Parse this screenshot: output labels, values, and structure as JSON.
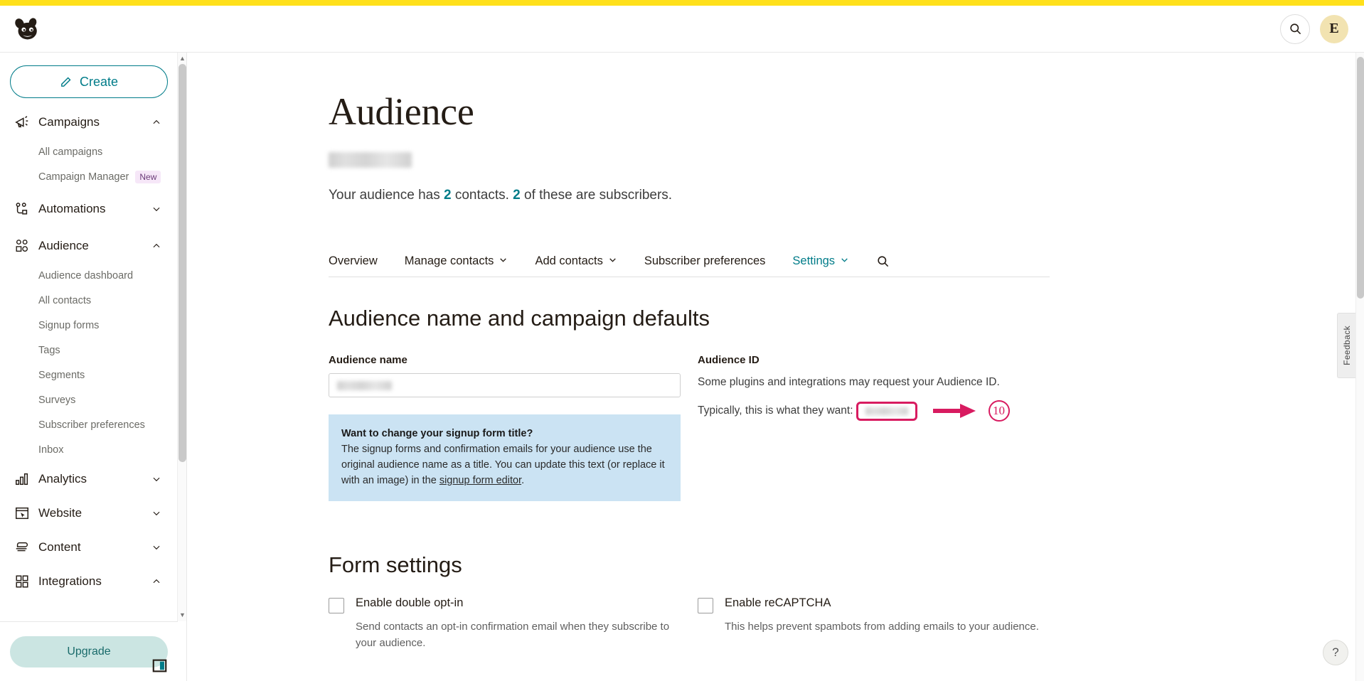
{
  "header": {
    "logo_name": "mailchimp-logo",
    "search_icon": "search-icon",
    "avatar_initial": "E"
  },
  "sidebar": {
    "create_label": "Create",
    "groups": [
      {
        "label": "Campaigns",
        "icon": "megaphone-icon",
        "expanded": true,
        "chevron": "chevron-up",
        "items": [
          {
            "label": "All campaigns",
            "badge": ""
          },
          {
            "label": "Campaign Manager",
            "badge": "New"
          }
        ]
      },
      {
        "label": "Automations",
        "icon": "automations-icon",
        "expanded": false,
        "chevron": "chevron-down",
        "items": []
      },
      {
        "label": "Audience",
        "icon": "audience-icon",
        "expanded": true,
        "chevron": "chevron-up",
        "items": [
          {
            "label": "Audience dashboard",
            "badge": ""
          },
          {
            "label": "All contacts",
            "badge": ""
          },
          {
            "label": "Signup forms",
            "badge": ""
          },
          {
            "label": "Tags",
            "badge": ""
          },
          {
            "label": "Segments",
            "badge": ""
          },
          {
            "label": "Surveys",
            "badge": ""
          },
          {
            "label": "Subscriber preferences",
            "badge": ""
          },
          {
            "label": "Inbox",
            "badge": ""
          }
        ]
      },
      {
        "label": "Analytics",
        "icon": "bar-chart-icon",
        "expanded": false,
        "chevron": "chevron-down",
        "items": []
      },
      {
        "label": "Website",
        "icon": "website-icon",
        "expanded": false,
        "chevron": "chevron-down",
        "items": []
      },
      {
        "label": "Content",
        "icon": "content-icon",
        "expanded": false,
        "chevron": "chevron-down",
        "items": []
      },
      {
        "label": "Integrations",
        "icon": "grid-icon",
        "expanded": true,
        "chevron": "chevron-up",
        "items": []
      }
    ],
    "upgrade_label": "Upgrade",
    "panel_toggle_icon": "panel-collapse-icon"
  },
  "page": {
    "title": "Audience",
    "audience_name_redacted": true,
    "contacts_prefix": "Your audience has ",
    "contacts_count": "2",
    "contacts_middle": " contacts. ",
    "subscribers_count": "2",
    "contacts_suffix": " of these are subscribers."
  },
  "tabs": [
    {
      "label": "Overview",
      "has_caret": false,
      "active": false
    },
    {
      "label": "Manage contacts",
      "has_caret": true,
      "active": false
    },
    {
      "label": "Add contacts",
      "has_caret": true,
      "active": false
    },
    {
      "label": "Subscriber preferences",
      "has_caret": false,
      "active": false
    },
    {
      "label": "Settings",
      "has_caret": true,
      "active": true
    }
  ],
  "tab_search_icon": "search-icon",
  "settings": {
    "section_title": "Audience name and campaign defaults",
    "audience_name_label": "Audience name",
    "audience_name_value_redacted": true,
    "callout": {
      "title": "Want to change your signup form title?",
      "body_part1": "The signup forms and confirmation emails for your audience use the original audience name as a title. You can update this text (or replace it with an image) in the ",
      "link": "signup form editor",
      "body_part2": "."
    },
    "audience_id_label": "Audience ID",
    "audience_id_desc": "Some plugins and integrations may request your Audience ID.",
    "audience_id_typical_prefix": "Typically, this is what they want:",
    "audience_id_value_redacted": true
  },
  "annotation": {
    "color": "#D81B60",
    "arrow_icon": "arrow-right-annotation",
    "step_number": "10"
  },
  "form_settings": {
    "title": "Form settings",
    "options": [
      {
        "label": "Enable double opt-in",
        "description": "Send contacts an opt-in confirmation email when they subscribe to your audience.",
        "checked": false
      },
      {
        "label": "Enable reCAPTCHA",
        "description": "This helps prevent spambots from adding emails to your audience.",
        "checked": false
      }
    ]
  },
  "rail": {
    "feedback_label": "Feedback",
    "help_label": "?"
  },
  "colors": {
    "brand_yellow": "#FFE01B",
    "teal": "#007c89",
    "callout_blue": "#CBE3F3",
    "annotation_pink": "#D81B60",
    "upgrade_mint": "#CBE5E2"
  }
}
